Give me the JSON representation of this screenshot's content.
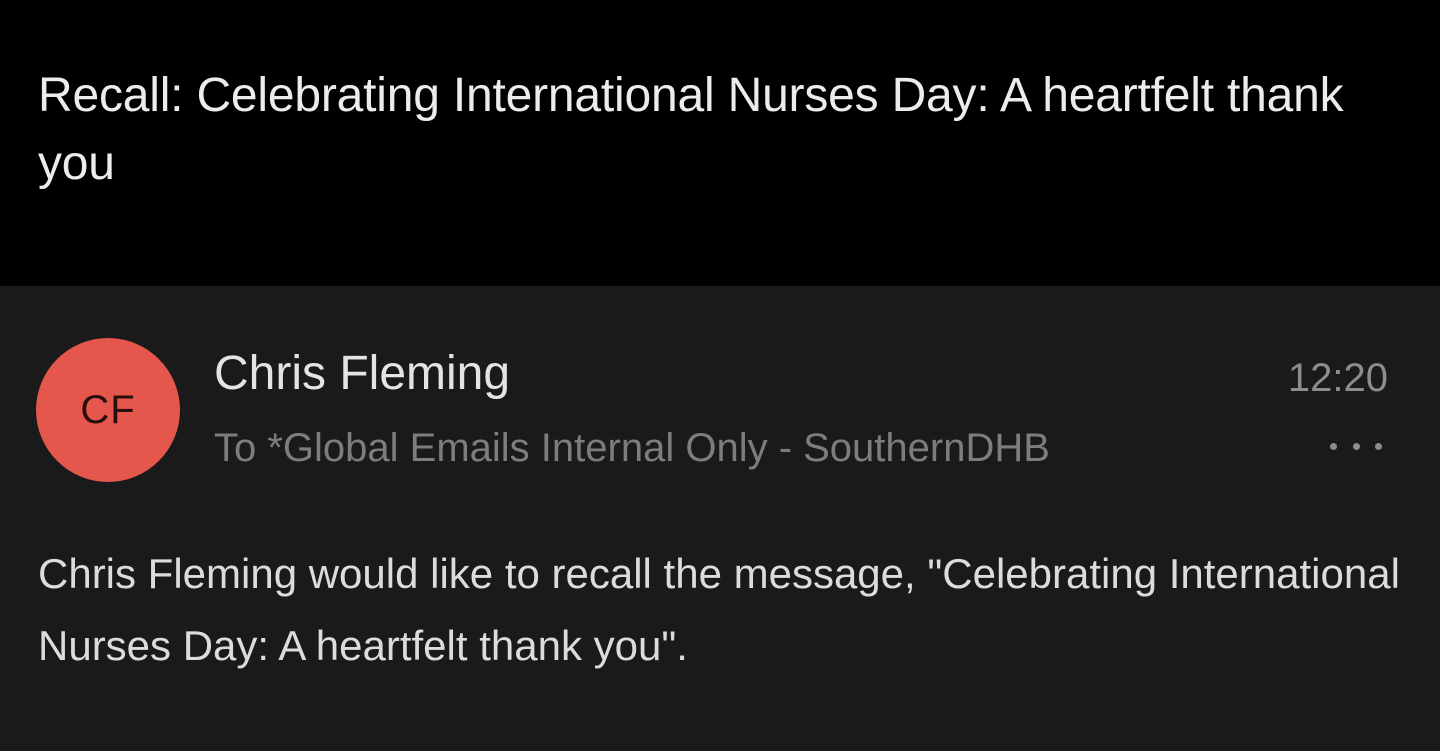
{
  "subject": "Recall: Celebrating International Nurses Day: A heartfelt thank you",
  "message": {
    "avatar_initials": "CF",
    "sender_name": "Chris Fleming",
    "time": "12:20",
    "recipients": "To *Global Emails Internal Only - SouthernDHB",
    "more_icon": "more-horizontal-icon",
    "body": "Chris Fleming would like to recall the message, \"Celebrating International Nurses Day: A heartfelt thank you\"."
  },
  "colors": {
    "subject_background": "#000000",
    "message_background": "#1a1a1a",
    "avatar_background": "#e5564c"
  }
}
